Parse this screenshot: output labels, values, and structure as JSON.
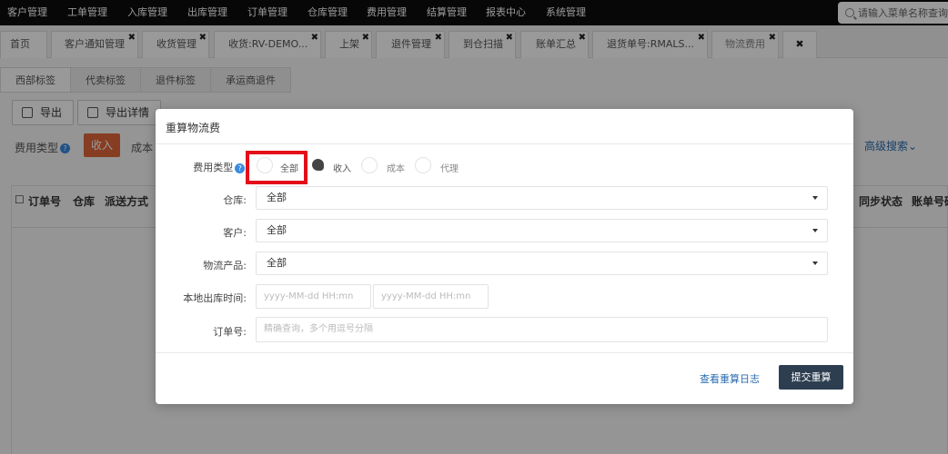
{
  "topnav": {
    "items": [
      "客户管理",
      "工单管理",
      "入库管理",
      "出库管理",
      "订单管理",
      "仓库管理",
      "费用管理",
      "结算管理",
      "报表中心",
      "系统管理"
    ],
    "search_placeholder": "请输入菜单名称查询"
  },
  "tabs": [
    {
      "label": "首页"
    },
    {
      "label": "客户通知管理"
    },
    {
      "label": "收货管理"
    },
    {
      "label": "收货:RV-DEMO..."
    },
    {
      "label": "上架"
    },
    {
      "label": "退件管理"
    },
    {
      "label": "到仓扫描"
    },
    {
      "label": "账单汇总"
    },
    {
      "label": "退货单号:RMALS..."
    },
    {
      "label": "物流费用"
    }
  ],
  "page": {
    "subtabs": [
      "西部标签",
      "代卖标签",
      "退件标签",
      "承运商退件"
    ],
    "toolbar": {
      "export": "导出",
      "export_detail": "导出详情"
    },
    "fee_type_label": "费用类型",
    "chip_income": "收入",
    "chip_cost": "成本",
    "advanced_search": "高级搜索",
    "columns": {
      "order_no": "订单号",
      "warehouse": "仓库",
      "delivery": "派送方式",
      "sync": "同步状态",
      "bill": "账单号码"
    }
  },
  "modal": {
    "title": "重算物流费",
    "fee_type": {
      "label": "费用类型",
      "options": [
        {
          "label": "全部",
          "checked": false
        },
        {
          "label": "收入",
          "checked": true
        },
        {
          "label": "成本",
          "checked": false
        },
        {
          "label": "代理",
          "checked": false
        }
      ]
    },
    "warehouse": {
      "label": "仓库:",
      "value": "全部"
    },
    "customer": {
      "label": "客户:",
      "value": "全部"
    },
    "product": {
      "label": "物流产品:",
      "value": "全部"
    },
    "time": {
      "label": "本地出库时间:",
      "start_placeholder": "yyyy-MM-dd HH:mn",
      "end_placeholder": "yyyy-MM-dd HH:mn"
    },
    "order": {
      "label": "订单号:",
      "placeholder": "精确查询，多个用逗号分隔"
    },
    "view_log": "查看重算日志",
    "submit": "提交重算"
  }
}
